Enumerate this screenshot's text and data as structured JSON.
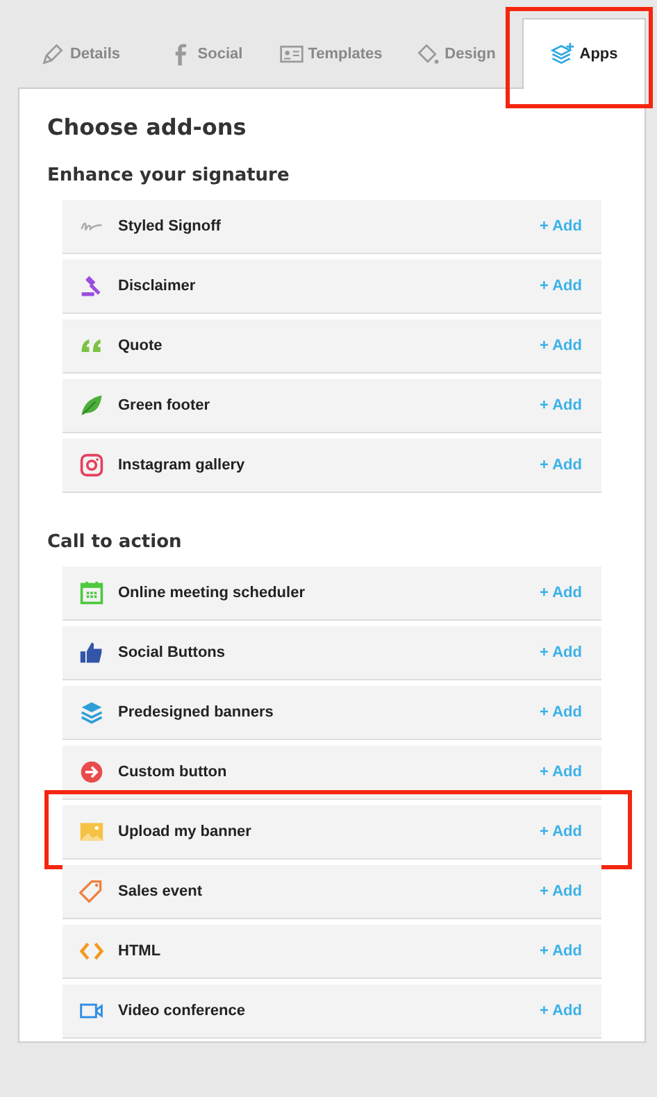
{
  "tabs": [
    {
      "label": "Details",
      "kind": "pencil",
      "selected": false,
      "highlighted": false
    },
    {
      "label": "Social",
      "kind": "facebook",
      "selected": false,
      "highlighted": false
    },
    {
      "label": "Templates",
      "kind": "card",
      "selected": false,
      "highlighted": false
    },
    {
      "label": "Design",
      "kind": "bucket",
      "selected": false,
      "highlighted": false
    },
    {
      "label": "Apps",
      "kind": "layers-plus",
      "selected": true,
      "highlighted": true
    }
  ],
  "panel": {
    "title": "Choose add-ons",
    "sections": [
      {
        "heading": "Enhance your signature",
        "items": [
          {
            "name": "Styled Signoff",
            "kind": "signature",
            "action": "+ Add",
            "highlighted": false
          },
          {
            "name": "Disclaimer",
            "kind": "gavel",
            "action": "+ Add",
            "highlighted": false
          },
          {
            "name": "Quote",
            "kind": "quote",
            "action": "+ Add",
            "highlighted": false
          },
          {
            "name": "Green footer",
            "kind": "leaf",
            "action": "+ Add",
            "highlighted": false
          },
          {
            "name": "Instagram gallery",
            "kind": "instagram",
            "action": "+ Add",
            "highlighted": false
          }
        ]
      },
      {
        "heading": "Call to action",
        "items": [
          {
            "name": "Online meeting scheduler",
            "kind": "calendar",
            "action": "+ Add",
            "highlighted": false
          },
          {
            "name": "Social Buttons",
            "kind": "thumb",
            "action": "+ Add",
            "highlighted": false
          },
          {
            "name": "Predesigned banners",
            "kind": "layers",
            "action": "+ Add",
            "highlighted": false
          },
          {
            "name": "Custom button",
            "kind": "arrow-circle",
            "action": "+ Add",
            "highlighted": false
          },
          {
            "name": "Upload my banner",
            "kind": "image",
            "action": "+ Add",
            "highlighted": true
          },
          {
            "name": "Sales event",
            "kind": "tag",
            "action": "+ Add",
            "highlighted": false
          },
          {
            "name": "HTML",
            "kind": "code",
            "action": "+ Add",
            "highlighted": false
          },
          {
            "name": "Video conference",
            "kind": "video",
            "action": "+ Add",
            "highlighted": false
          }
        ]
      }
    ]
  }
}
